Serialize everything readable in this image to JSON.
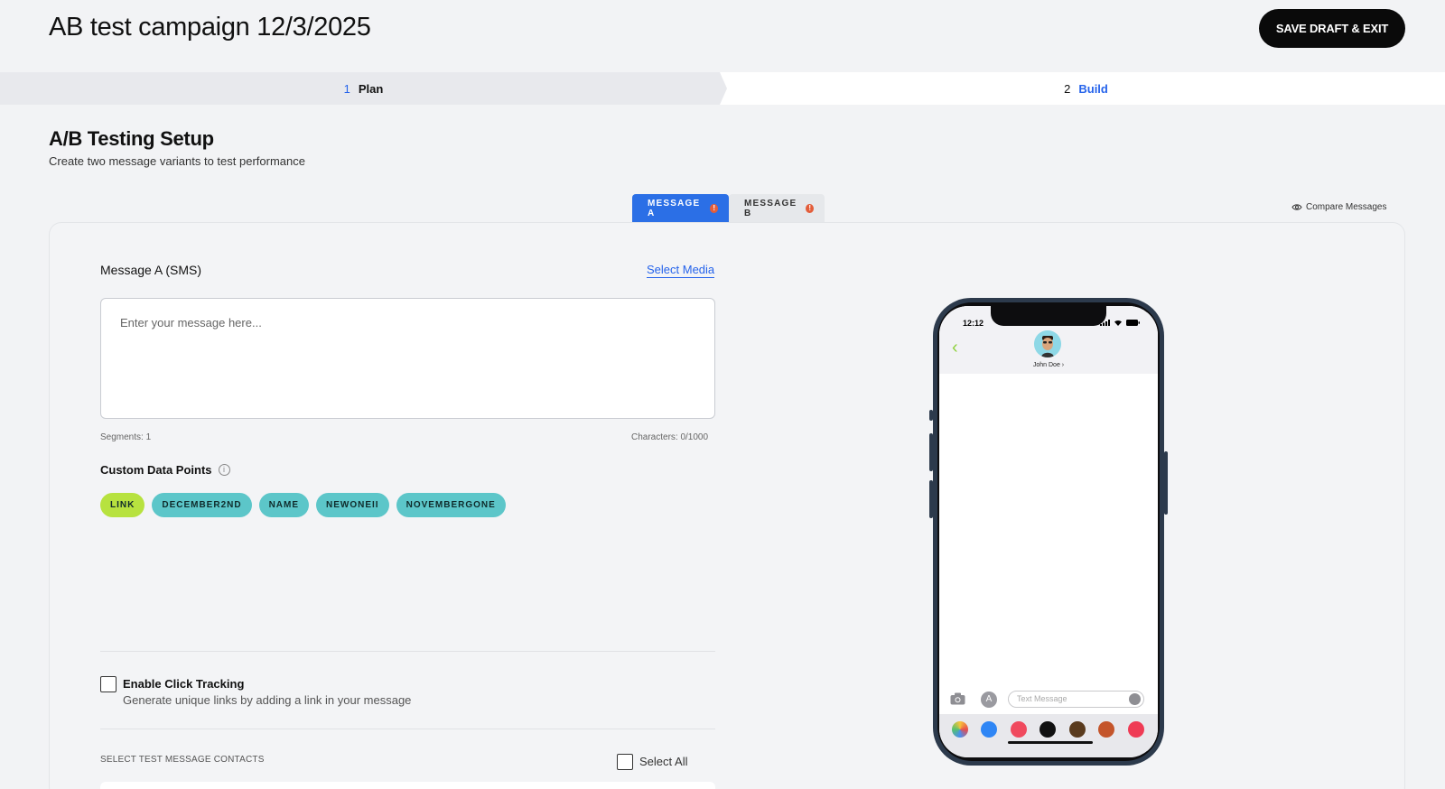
{
  "header": {
    "title": "AB test campaign 12/3/2025",
    "save_label": "SAVE DRAFT & EXIT"
  },
  "stepper": {
    "steps": [
      {
        "num": "1",
        "label": "Plan"
      },
      {
        "num": "2",
        "label": "Build"
      }
    ]
  },
  "section": {
    "title": "A/B Testing Setup",
    "subtitle": "Create two message variants to test performance"
  },
  "tabs": [
    {
      "label": "MESSAGE A",
      "alert": "!"
    },
    {
      "label": "MESSAGE B",
      "alert": "!"
    }
  ],
  "compare_label": "Compare Messages",
  "message": {
    "label": "Message A (SMS)",
    "select_media": "Select Media",
    "placeholder": "Enter your message here...",
    "segments": "Segments: 1",
    "characters": "Characters: 0/1000"
  },
  "custom_data_points": {
    "label": "Custom Data Points",
    "info": "i",
    "chips": [
      "LINK",
      "DECEMBER2ND",
      "NAME",
      "NEWONEII",
      "NOVEMBERGONE"
    ]
  },
  "click_tracking": {
    "label": "Enable Click Tracking",
    "description": "Generate unique links by adding a link in your message"
  },
  "contacts": {
    "label": "SELECT TEST MESSAGE CONTACTS",
    "select_all": "Select All"
  },
  "phone": {
    "time": "12:12",
    "contact_name": "John Doe ›",
    "back": "‹",
    "apps_glyph": "A",
    "text_placeholder": "Text Message"
  },
  "colors": {
    "accent": "#2563eb",
    "tab_active": "#2b6fe6",
    "chip_lime": "#b7e23f",
    "chip_teal": "#5cc6c9",
    "alert": "#e35d3a",
    "phone_frame": "#2c3a4c"
  },
  "icons": [
    "eye-icon",
    "info-icon",
    "camera-icon",
    "app-store-icon",
    "signal-icon",
    "wifi-icon",
    "battery-icon",
    "back-chevron-icon",
    "mic-icon"
  ]
}
